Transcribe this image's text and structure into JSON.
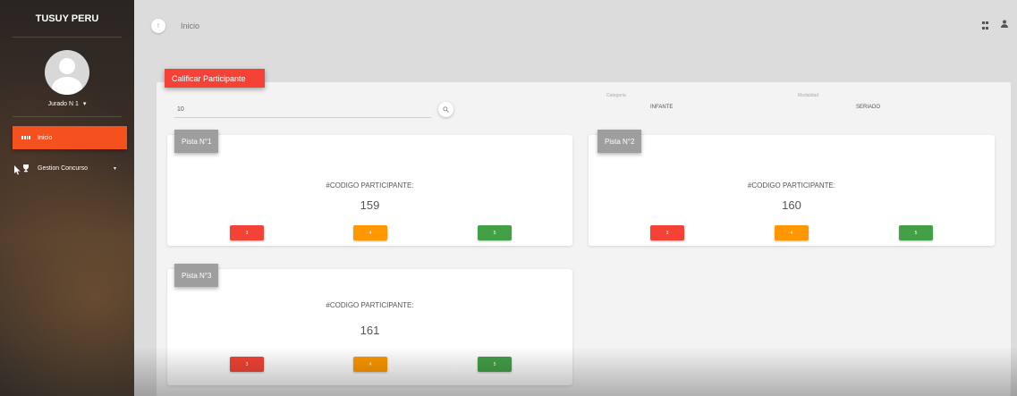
{
  "sidebar": {
    "brand": "TUSUY PERU",
    "user_name": "Jurado N 1",
    "user_caret": "▾",
    "items": [
      {
        "label": "Inicio"
      },
      {
        "label": "Gestion Concurso",
        "caret": "▾"
      }
    ]
  },
  "topbar": {
    "badge": "!",
    "crumb": "Inicio"
  },
  "panel": {
    "header": "Calificar Participante",
    "search_value": "10",
    "category_label": "Categoria",
    "category_value": "INFANTE",
    "modality_label": "Modalidad",
    "modality_value": "SERIADO"
  },
  "cards": [
    {
      "tag": "Pista N°1",
      "title": "#CODIGO PARTICIPANTE:",
      "code": "159",
      "buttons": [
        "3",
        "4",
        "5"
      ]
    },
    {
      "tag": "Pista N°2",
      "title": "#CODIGO PARTICIPANTE:",
      "code": "160",
      "buttons": [
        "3",
        "4",
        "5"
      ]
    },
    {
      "tag": "Pista N°3",
      "title": "#CODIGO PARTICIPANTE:",
      "code": "161",
      "buttons": [
        "3",
        "4",
        "5"
      ]
    }
  ],
  "colors": {
    "accent": "#f4511e",
    "red": "#f44336",
    "orange": "#ff9800",
    "green": "#43a047",
    "tag_gray": "#9e9e9e"
  },
  "icons": {
    "inicio": "dashboard-icon",
    "gestion": "trophy-icon",
    "search": "search-icon",
    "apps": "apps-icon",
    "user": "user-icon"
  }
}
